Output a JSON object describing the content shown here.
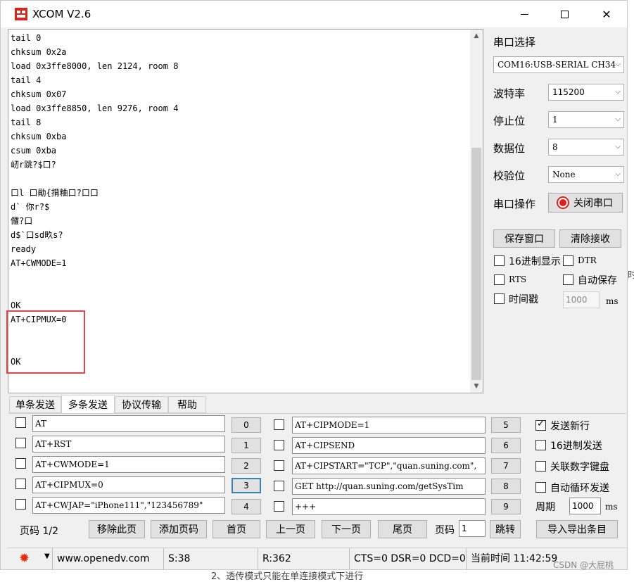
{
  "window": {
    "title": "XCOM V2.6"
  },
  "receive": {
    "lines": "tail 0\nchksum 0x2a\nload 0x3ffe8000, len 2124, room 8\ntail 4\nchksum 0x07\nload 0x3ffe8850, len 9276, room 4\ntail 8\nchksum 0xba\ncsum 0xba\n屻r跳?$口?\n\n口l 口勛{揹粬口?口口\nd` 你r?$\n儸?口\nd$`口sd畂s?\nready\nAT+CWMODE=1\n\n\nOK\nAT+CIPMUX=0\n\n\nOK"
  },
  "right_panel": {
    "port_label": "串口选择",
    "port_value": "COM16:USB-SERIAL CH34",
    "baud_label": "波特率",
    "baud_value": "115200",
    "stop_label": "停止位",
    "stop_value": "1",
    "data_label": "数据位",
    "data_value": "8",
    "parity_label": "校验位",
    "parity_value": "None",
    "op_label": "串口操作",
    "close_port": "关闭串口",
    "save_window": "保存窗口",
    "clear_receive": "清除接收",
    "hex_display": "16进制显示",
    "dtr": "DTR",
    "rts": "RTS",
    "auto_save": "自动保存",
    "timestamp": "时间戳",
    "timestamp_ms": "1000",
    "ms": "ms"
  },
  "tabs": [
    "单条发送",
    "多条发送",
    "协议传输",
    "帮助"
  ],
  "commands_left": [
    {
      "text": "AT",
      "num": "0"
    },
    {
      "text": "AT+RST",
      "num": "1"
    },
    {
      "text": "AT+CWMODE=1",
      "num": "2"
    },
    {
      "text": "AT+CIPMUX=0",
      "num": "3"
    },
    {
      "text": "AT+CWJAP=\"iPhone111\",\"123456789\"",
      "num": "4"
    }
  ],
  "commands_right": [
    {
      "text": "AT+CIPMODE=1",
      "num": "5"
    },
    {
      "text": "AT+CIPSEND",
      "num": "6"
    },
    {
      "text": "AT+CIPSTART=\"TCP\",\"quan.suning.com\",",
      "num": "7"
    },
    {
      "text": "GET http://quan.suning.com/getSysTim",
      "num": "8"
    },
    {
      "text": "+++",
      "num": "9"
    }
  ],
  "send_options": {
    "newline": "发送新行",
    "hex_send": "16进制发送",
    "numpad": "关联数字键盘",
    "auto_loop": "自动循环发送",
    "period_label": "周期",
    "period_value": "1000",
    "ms": "ms"
  },
  "pager": {
    "page_label": "页码 1/2",
    "remove_page": "移除此页",
    "add_page": "添加页码",
    "first": "首页",
    "prev": "上一页",
    "next": "下一页",
    "last": "尾页",
    "goto_label": "页码",
    "goto_value": "1",
    "jump": "跳转",
    "import_export": "导入导出条目"
  },
  "status": {
    "url": "www.openedv.com",
    "sent": "S:38",
    "recv": "R:362",
    "lines": "CTS=0 DSR=0 DCD=0",
    "time": "当前时间 11:42:59"
  },
  "page_fragments": {
    "below": "2、透传模式只能在单连接模式下进行",
    "watermark": "CSDN @大屁桃",
    "side": "时"
  }
}
